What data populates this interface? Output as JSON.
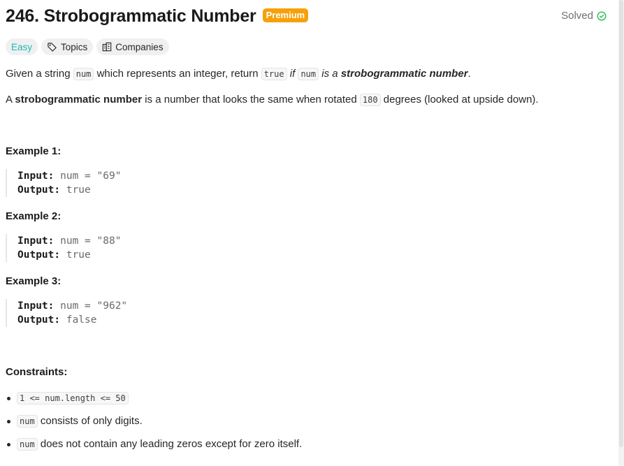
{
  "header": {
    "title": "246. Strobogrammatic Number",
    "premium_label": "Premium",
    "status_label": "Solved"
  },
  "tags": {
    "difficulty": "Easy",
    "topics": "Topics",
    "companies": "Companies"
  },
  "description": {
    "p1": {
      "t1": "Given a string ",
      "c1": "num",
      "t2": " which represents an integer, return ",
      "c2": "true",
      "t3": " if ",
      "c3": "num",
      "t4": " is a ",
      "t5": "strobogrammatic number",
      "t6": "."
    },
    "p2": {
      "t1": "A ",
      "t2": "strobogrammatic number",
      "t3": " is a number that looks the same when rotated ",
      "c1": "180",
      "t4": " degrees (looked at upside down)."
    }
  },
  "examples": [
    {
      "heading": "Example 1:",
      "input_label": "Input:",
      "input_value": "num = \"69\"",
      "output_label": "Output:",
      "output_value": "true"
    },
    {
      "heading": "Example 2:",
      "input_label": "Input:",
      "input_value": "num = \"88\"",
      "output_label": "Output:",
      "output_value": "true"
    },
    {
      "heading": "Example 3:",
      "input_label": "Input:",
      "input_value": "num = \"962\"",
      "output_label": "Output:",
      "output_value": "false"
    }
  ],
  "constraints": {
    "heading": "Constraints:",
    "items": [
      {
        "code": "1 <= num.length <= 50",
        "text": ""
      },
      {
        "code": "num",
        "text": " consists of only digits."
      },
      {
        "code": "num",
        "text": " does not contain any leading zeros except for zero itself."
      }
    ]
  },
  "colors": {
    "premium": "#f5a10a",
    "easy": "#1cb8b8",
    "solved_check": "#2cbb5d"
  },
  "icons": [
    "tag-icon",
    "companies-icon",
    "check-circle-icon"
  ]
}
